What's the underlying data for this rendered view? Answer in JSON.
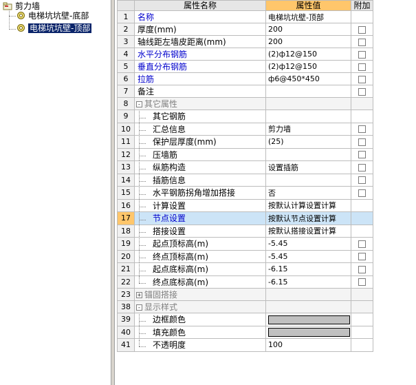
{
  "tree": {
    "root": "剪力墙",
    "children": [
      "电梯坑坑壁-底部",
      "电梯坑坑壁-顶部"
    ],
    "selected_index": 1
  },
  "grid": {
    "headers": {
      "num": "",
      "name": "属性名称",
      "value": "属性值",
      "add": "附加"
    },
    "rows": [
      {
        "num": "1",
        "name": "名称",
        "value": "电梯坑坑壁-顶部",
        "style": "blue",
        "checkbox": false
      },
      {
        "num": "2",
        "name": "厚度(mm)",
        "value": "200",
        "style": "normal",
        "checkbox": true
      },
      {
        "num": "3",
        "name": "轴线距左墙皮距离(mm)",
        "value": "200",
        "style": "normal",
        "checkbox": true
      },
      {
        "num": "4",
        "name": "水平分布钢筋",
        "value": "(2)ф12@150",
        "style": "blue",
        "checkbox": true
      },
      {
        "num": "5",
        "name": "垂直分布钢筋",
        "value": "(2)ф12@150",
        "style": "blue",
        "checkbox": true
      },
      {
        "num": "6",
        "name": "拉筋",
        "value": "ф6@450*450",
        "style": "blue",
        "checkbox": true
      },
      {
        "num": "7",
        "name": "备注",
        "value": "",
        "style": "normal",
        "checkbox": true
      },
      {
        "num": "8",
        "name": "其它属性",
        "value": "",
        "style": "group",
        "toggle": "-",
        "checkbox": false
      },
      {
        "num": "9",
        "name": "其它钢筋",
        "value": "",
        "style": "child",
        "checkbox": false
      },
      {
        "num": "10",
        "name": "汇总信息",
        "value": "剪力墙",
        "style": "child",
        "checkbox": true
      },
      {
        "num": "11",
        "name": "保护层厚度(mm)",
        "value": "(25)",
        "style": "child",
        "checkbox": true
      },
      {
        "num": "12",
        "name": "压墙筋",
        "value": "",
        "style": "child",
        "checkbox": true
      },
      {
        "num": "13",
        "name": "纵筋构造",
        "value": "设置插筋",
        "style": "child",
        "checkbox": true
      },
      {
        "num": "14",
        "name": "插筋信息",
        "value": "",
        "style": "child",
        "checkbox": true
      },
      {
        "num": "15",
        "name": "水平钢筋拐角增加搭接",
        "value": "否",
        "style": "child",
        "checkbox": true
      },
      {
        "num": "16",
        "name": "计算设置",
        "value": "按默认计算设置计算",
        "style": "child",
        "checkbox": false
      },
      {
        "num": "17",
        "name": "节点设置",
        "value": "按默认节点设置计算",
        "style": "child",
        "checkbox": false,
        "selected": true
      },
      {
        "num": "18",
        "name": "搭接设置",
        "value": "按默认搭接设置计算",
        "style": "child",
        "checkbox": false
      },
      {
        "num": "19",
        "name": "起点顶标高(m)",
        "value": "-5.45",
        "style": "child",
        "checkbox": true
      },
      {
        "num": "20",
        "name": "终点顶标高(m)",
        "value": "-5.45",
        "style": "child",
        "checkbox": true
      },
      {
        "num": "21",
        "name": "起点底标高(m)",
        "value": "-6.15",
        "style": "child",
        "checkbox": true
      },
      {
        "num": "22",
        "name": "终点底标高(m)",
        "value": "-6.15",
        "style": "child",
        "last": true,
        "checkbox": true
      },
      {
        "num": "23",
        "name": "锚固搭接",
        "value": "",
        "style": "group",
        "toggle": "+",
        "checkbox": false
      },
      {
        "num": "38",
        "name": "显示样式",
        "value": "",
        "style": "group",
        "toggle": "-",
        "checkbox": false
      },
      {
        "num": "39",
        "name": "边框颜色",
        "value": "",
        "style": "child",
        "swatch": "#c0c0c0",
        "checkbox": false
      },
      {
        "num": "40",
        "name": "填充颜色",
        "value": "",
        "style": "child",
        "swatch": "#c0c0c0",
        "checkbox": false
      },
      {
        "num": "41",
        "name": "不透明度",
        "value": "100",
        "style": "child",
        "last": true,
        "checkbox": false
      }
    ]
  }
}
